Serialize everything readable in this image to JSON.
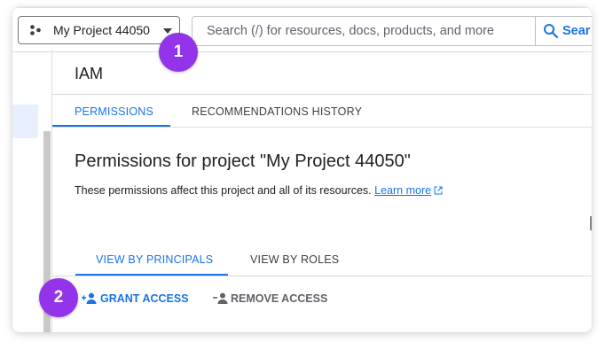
{
  "header": {
    "project_name": "My Project 44050",
    "search_placeholder": "Search (/) for resources, docs, products, and more",
    "search_button_label": "Sear"
  },
  "page": {
    "title": "IAM",
    "tabs": [
      {
        "label": "PERMISSIONS",
        "active": true
      },
      {
        "label": "RECOMMENDATIONS HISTORY",
        "active": false
      }
    ],
    "heading": "Permissions for project \"My Project 44050\"",
    "description": "These permissions affect this project and all of its resources.",
    "learn_more": "Learn more",
    "view_tabs": [
      {
        "label": "VIEW BY PRINCIPALS",
        "active": true
      },
      {
        "label": "VIEW BY ROLES",
        "active": false
      }
    ],
    "actions": {
      "grant": "GRANT ACCESS",
      "remove": "REMOVE ACCESS"
    }
  },
  "badges": [
    "1",
    "2"
  ],
  "colors": {
    "accent": "#1a73e8",
    "badge": "#9333ea",
    "selected_rail": "#e8f0fe"
  },
  "icons": {
    "project": "project-dots-icon",
    "caret": "caret-down-icon",
    "search": "search-icon",
    "external": "external-link-icon",
    "grant": "person-add-icon",
    "remove": "person-remove-icon"
  }
}
